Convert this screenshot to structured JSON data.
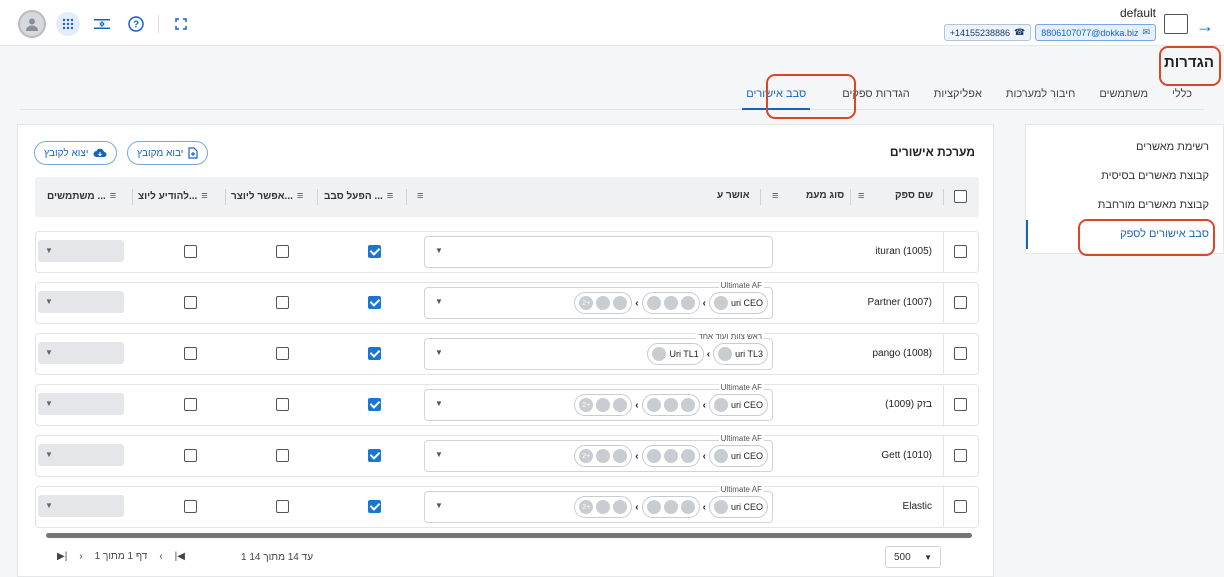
{
  "header": {
    "account_name": "default",
    "phone": "+14155238886",
    "email": "8806107077@dokka.biz"
  },
  "page": {
    "title": "הגדרות"
  },
  "tabs": [
    {
      "label": "כללי"
    },
    {
      "label": "משתמשים"
    },
    {
      "label": "חיבור למערכות"
    },
    {
      "label": "אפליקציות"
    },
    {
      "label": "הגדרות ספקים"
    },
    {
      "label": "סבב אישורים",
      "active": true
    }
  ],
  "sidebar": {
    "items": [
      {
        "label": "רשימת מאשרים"
      },
      {
        "label": "קבוצת מאשרים בסיסית"
      },
      {
        "label": "קבוצת מאשרים מורחבת"
      },
      {
        "label": "סבב אישורים לספק",
        "active": true
      }
    ]
  },
  "panel": {
    "title": "מערכת אישורים",
    "import_label": "יבוא מקובץ",
    "export_label": "יצוא לקובץ"
  },
  "table": {
    "columns": {
      "vendor_name": "שם ספק",
      "vat_type": "סוג מעמ",
      "approver": "אושר ע",
      "enable_flow": "הפעל סבב ...",
      "allow_creator": "אפשר ליוצר...",
      "notify_creator": "להודיע ליוצ...",
      "users": "משתמשים ..."
    },
    "rows": [
      {
        "name": "ituran (1005)",
        "enabled": true,
        "allow": false,
        "notify": false,
        "legend": "",
        "chain": null
      },
      {
        "name": "Partner (1007)",
        "enabled": true,
        "allow": false,
        "notify": false,
        "legend": "Ultimate AF",
        "chain": {
          "first": "2+",
          "last": "uri CEO"
        }
      },
      {
        "name": "pango (1008)",
        "enabled": true,
        "allow": false,
        "notify": false,
        "legend": "ראש צוות ועוד אחד",
        "chain": {
          "first": "Uri TL1",
          "last": "uri TL3"
        }
      },
      {
        "name": "בזק (1009)",
        "enabled": true,
        "allow": false,
        "notify": false,
        "legend": "Ultimate AF",
        "chain": {
          "first": "2+",
          "last": "uri CEO"
        }
      },
      {
        "name": "Gett (1010)",
        "enabled": true,
        "allow": false,
        "notify": false,
        "legend": "Ultimate AF",
        "chain": {
          "first": "2+",
          "last": "uri CEO"
        }
      },
      {
        "name": "Elastic",
        "enabled": true,
        "allow": false,
        "notify": false,
        "legend": "Ultimate AF",
        "chain": {
          "first": "2+",
          "last": "uri CEO"
        }
      }
    ]
  },
  "pagination": {
    "page_size": "500",
    "range": "1 עד 14 מתוך 14",
    "page_info": "דף 1 מתוך 1"
  }
}
